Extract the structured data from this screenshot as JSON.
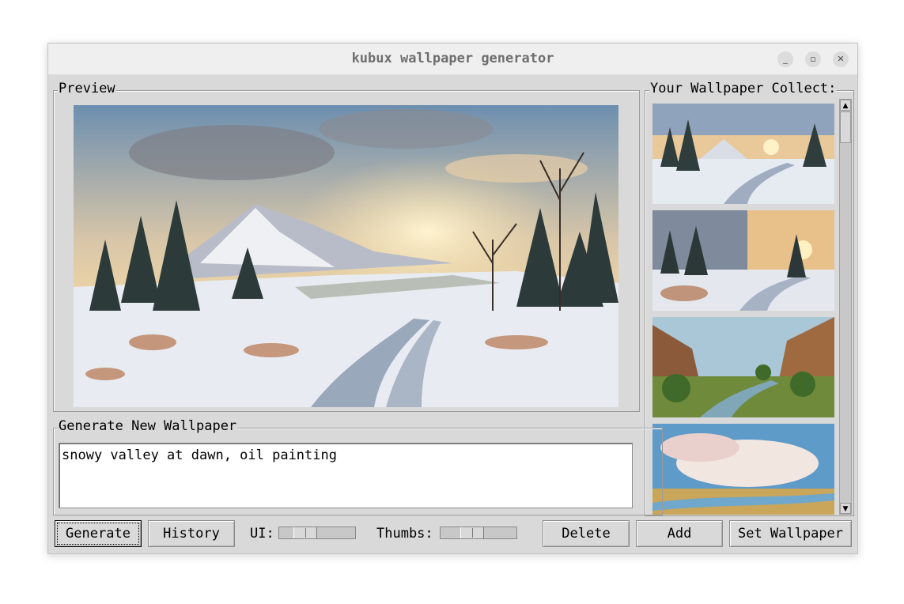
{
  "window": {
    "title": "kubux wallpaper generator"
  },
  "controls": {
    "minimize": "_",
    "maximize": "▫",
    "close": "✕"
  },
  "preview": {
    "label": "Preview"
  },
  "collection": {
    "label": "Your Wallpaper Collect:"
  },
  "generate": {
    "label": "Generate New Wallpaper",
    "prompt_value": "snowy valley at dawn, oil painting"
  },
  "toolbar": {
    "generate_label": "Generate",
    "history_label": "History",
    "ui_label": "UI:",
    "thumbs_label": "Thumbs:",
    "delete_label": "Delete",
    "add_label": "Add",
    "set_wallpaper_label": "Set Wallpaper"
  },
  "scrollbar": {
    "up": "▲",
    "down": "▼"
  }
}
